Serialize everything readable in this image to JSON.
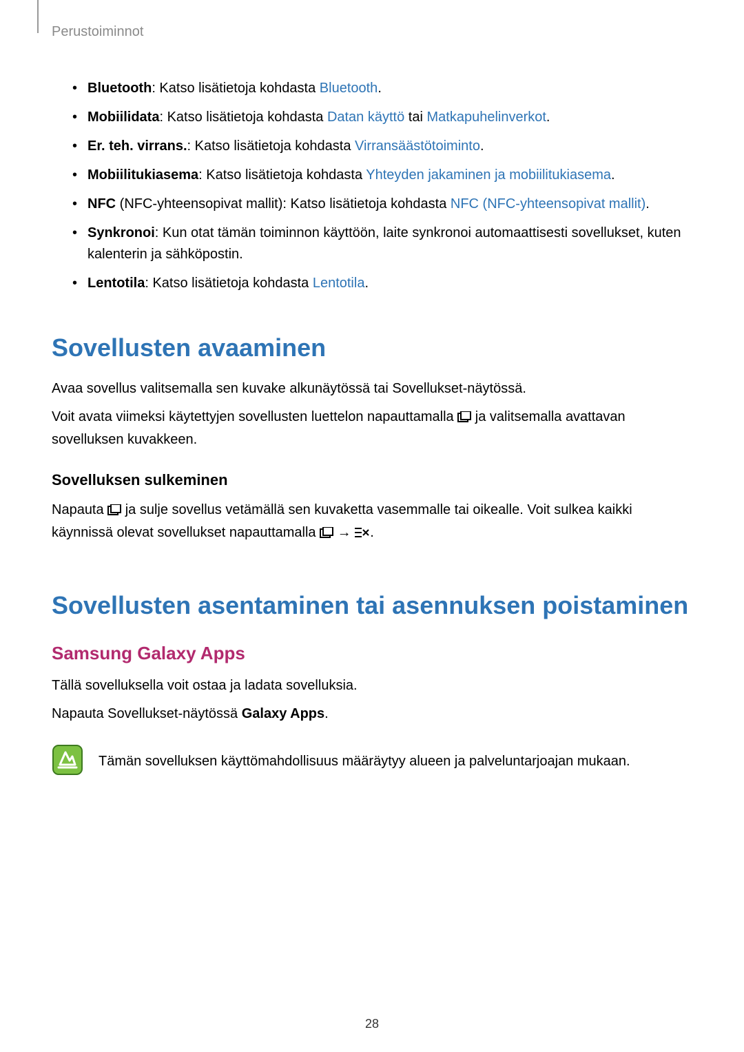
{
  "breadcrumb": "Perustoiminnot",
  "bullets": [
    {
      "bold": "Bluetooth",
      "pre": ": Katso lisätietoja kohdasta ",
      "link": "Bluetooth",
      "post": "."
    },
    {
      "bold": "Mobiilidata",
      "pre": ": Katso lisätietoja kohdasta ",
      "link": "Datan käyttö",
      "mid": " tai ",
      "link2": "Matkapuhelinverkot",
      "post": "."
    },
    {
      "bold": "Er. teh. virrans.",
      "pre": ": Katso lisätietoja kohdasta ",
      "link": "Virransäästötoiminto",
      "post": "."
    },
    {
      "bold": "Mobiilitukiasema",
      "pre": ": Katso lisätietoja kohdasta ",
      "link": "Yhteyden jakaminen ja mobiilitukiasema",
      "post": "."
    },
    {
      "bold": "NFC",
      "pre_plain": " (NFC-yhteensopivat mallit): Katso lisätietoja kohdasta ",
      "link": "NFC (NFC-yhteensopivat mallit)",
      "post": "."
    },
    {
      "bold": "Synkronoi",
      "plain": ": Kun otat tämän toiminnon käyttöön, laite synkronoi automaattisesti sovellukset, kuten kalenterin ja sähköpostin."
    },
    {
      "bold": "Lentotila",
      "pre": ": Katso lisätietoja kohdasta ",
      "link": "Lentotila",
      "post": "."
    }
  ],
  "h1_open": "Sovellusten avaaminen",
  "p_open_1": "Avaa sovellus valitsemalla sen kuvake alkunäytössä tai Sovellukset-näytössä.",
  "p_open_2a": "Voit avata viimeksi käytettyjen sovellusten luettelon napauttamalla ",
  "p_open_2b": " ja valitsemalla avattavan sovelluksen kuvakkeen.",
  "h3_close": "Sovelluksen sulkeminen",
  "p_close_a": "Napauta ",
  "p_close_b": " ja sulje sovellus vetämällä sen kuvaketta vasemmalle tai oikealle. Voit sulkea kaikki käynnissä olevat sovellukset napauttamalla ",
  "p_close_c": " → ",
  "p_close_d": ".",
  "h1_install": "Sovellusten asentaminen tai asennuksen poistaminen",
  "h2_galaxy": "Samsung Galaxy Apps",
  "p_galaxy_1": "Tällä sovelluksella voit ostaa ja ladata sovelluksia.",
  "p_galaxy_2a": "Napauta Sovellukset-näytössä ",
  "p_galaxy_2b": "Galaxy Apps",
  "p_galaxy_2c": ".",
  "note_text": "Tämän sovelluksen käyttömahdollisuus määräytyy alueen ja palveluntarjoajan mukaan.",
  "page_number": "28"
}
